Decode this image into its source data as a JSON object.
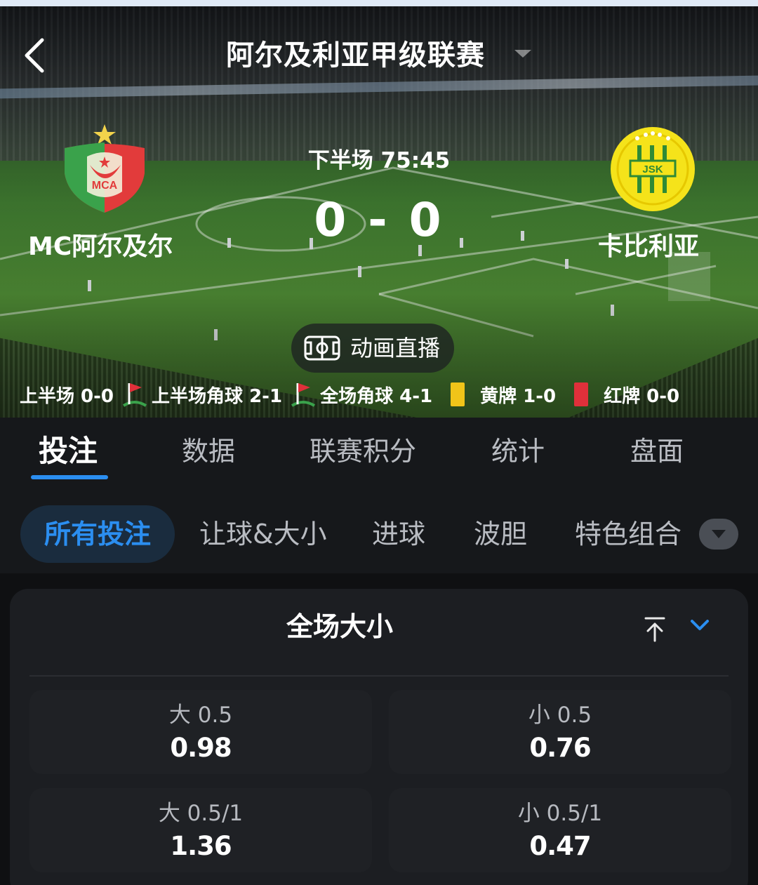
{
  "header": {
    "title": "阿尔及利亚甲级联赛"
  },
  "match": {
    "home": {
      "name": "MC阿尔及尔",
      "logo_text": "MCA"
    },
    "away": {
      "name": "卡比利亚",
      "logo_text": "JSK"
    },
    "period_time": "下半场 75:45",
    "score": "0 - 0",
    "animation_label": "动画直播"
  },
  "stats": {
    "first_half": "上半场 0-0",
    "first_half_corners": "上半场角球 2-1",
    "full_corners": "全场角球 4-1",
    "yellow_cards": "黄牌 1-0",
    "red_cards": "红牌 0-0"
  },
  "tabs": [
    {
      "label": "投注",
      "active": true
    },
    {
      "label": "数据"
    },
    {
      "label": "联赛积分"
    },
    {
      "label": "统计"
    },
    {
      "label": "盘面"
    }
  ],
  "subtabs": [
    {
      "label": "所有投注",
      "active": true
    },
    {
      "label": "让球&大小"
    },
    {
      "label": "进球"
    },
    {
      "label": "波胆"
    },
    {
      "label": "特色组合"
    }
  ],
  "market": {
    "title": "全场大小",
    "odds": [
      {
        "line": "大 0.5",
        "price": "0.98"
      },
      {
        "line": "小 0.5",
        "price": "0.76"
      },
      {
        "line": "大 0.5/1",
        "price": "1.36"
      },
      {
        "line": "小 0.5/1",
        "price": "0.47"
      }
    ]
  },
  "colors": {
    "accent": "#2b8ef0",
    "yellow_card": "#f0c419",
    "red_card": "#e0303a",
    "background": "#16181b"
  }
}
